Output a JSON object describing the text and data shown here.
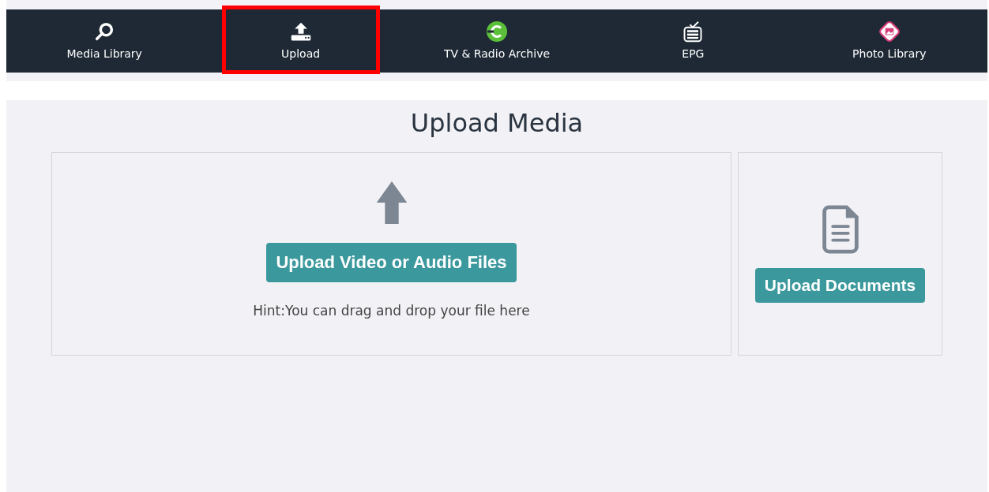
{
  "nav": {
    "items": [
      {
        "label": "Media Library",
        "kind": "search",
        "selected": false
      },
      {
        "label": "Upload",
        "kind": "upload",
        "selected": true
      },
      {
        "label": "TV & Radio Archive",
        "kind": "archive",
        "selected": false
      },
      {
        "label": "EPG",
        "kind": "tv",
        "selected": false
      },
      {
        "label": "Photo Library",
        "kind": "photo",
        "selected": false
      }
    ]
  },
  "page": {
    "title": "Upload Media",
    "media_panel": {
      "button": "Upload Video or Audio Files",
      "hint": "Hint:You can drag and drop your file here"
    },
    "documents_panel": {
      "button": "Upload Documents"
    }
  }
}
